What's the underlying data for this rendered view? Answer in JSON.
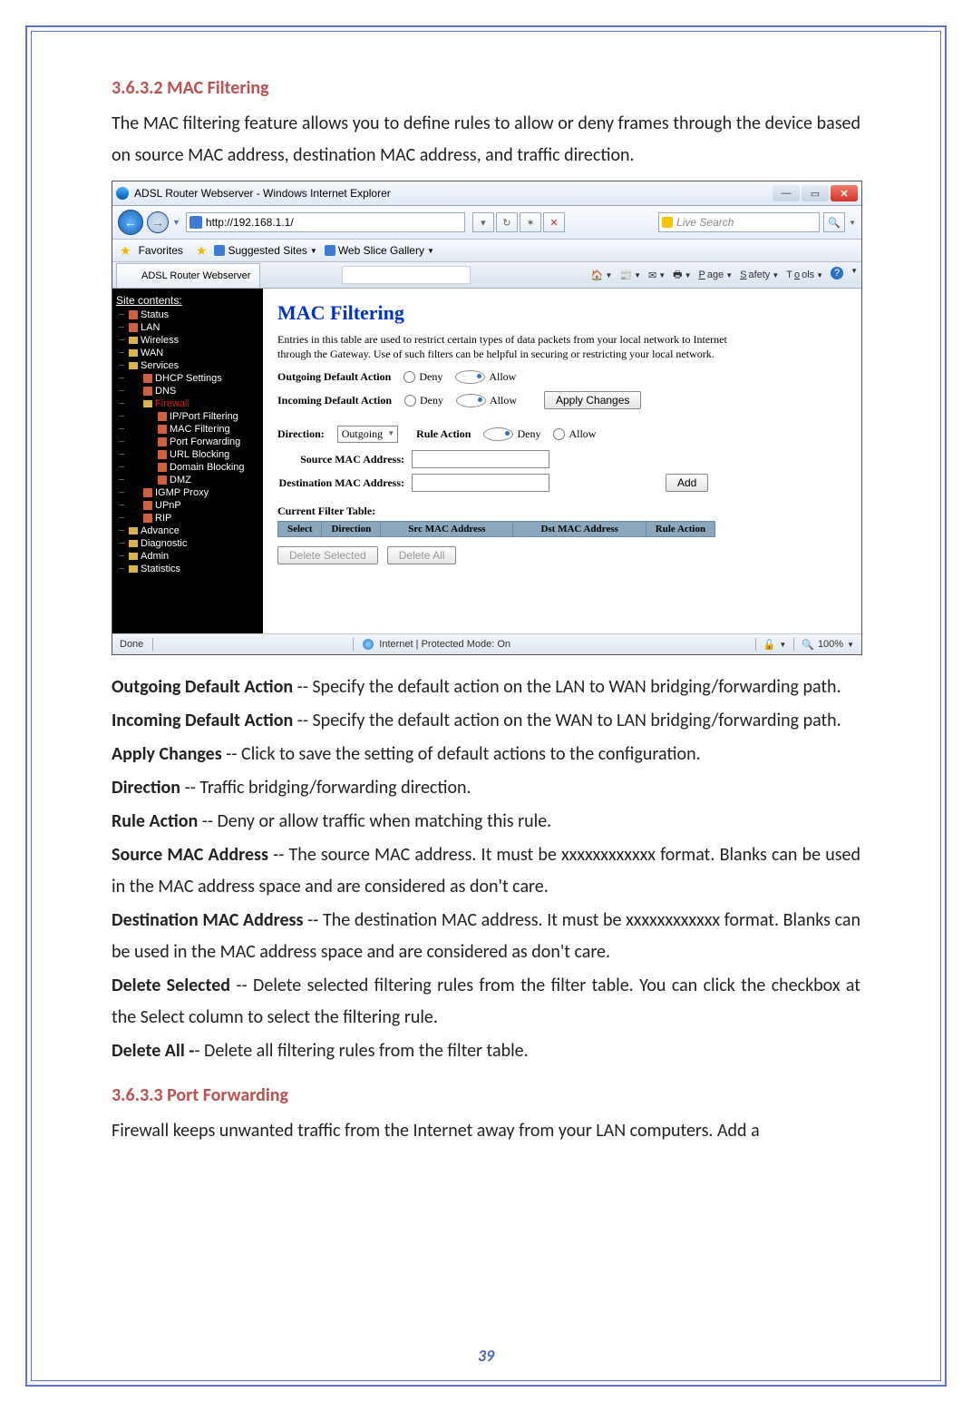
{
  "page_number": "39",
  "sections": {
    "s1": {
      "num": "3.6.3.2",
      "title": "MAC Filtering",
      "intro": "The MAC filtering feature allows you to define rules to allow or deny frames through the device based on source MAC address, destination MAC address, and traffic direction."
    },
    "s2": {
      "num": "3.6.3.3",
      "title": "Port Forwarding",
      "intro": "Firewall keeps unwanted traffic from the Internet away from your LAN computers. Add a"
    }
  },
  "definitions": [
    {
      "term": "Outgoing Default Action",
      "desc": " -- Specify the default action on the LAN to WAN bridging/forwarding path."
    },
    {
      "term": "Incoming Default Action",
      "desc": " -- Specify the default action on the WAN to LAN bridging/forwarding path."
    },
    {
      "term": "Apply Changes",
      "desc": " -- Click to save the setting of default actions to the configuration."
    },
    {
      "term": "Direction",
      "desc": " -- Traffic bridging/forwarding direction."
    },
    {
      "term": "Rule Action",
      "desc": " -- Deny or allow traffic when matching this rule."
    },
    {
      "term": "Source MAC Address",
      "desc": " -- The source MAC address. It must be xxxxxxxxxxxx format. Blanks can be used in the MAC address space and are considered as don't care."
    },
    {
      "term": "Destination MAC Address",
      "desc": " -- The destination MAC address. It must be xxxxxxxxxxxx format. Blanks can be used in the MAC address space and are considered as don't care."
    },
    {
      "term": "Delete Selected",
      "desc": " -- Delete selected filtering rules from the filter table. You can click the checkbox at the Select column to select the filtering rule."
    },
    {
      "term": "Delete All -",
      "desc": "- Delete all filtering rules from the filter table."
    }
  ],
  "ie": {
    "title": "ADSL Router Webserver - Windows Internet Explorer",
    "url": "http://192.168.1.1/",
    "search_placeholder": "Live Search",
    "fav_label": "Favorites",
    "fav_links": [
      "Suggested Sites",
      "Web Slice Gallery"
    ],
    "tab_label": "ADSL Router Webserver",
    "toolbar": [
      "Page",
      "Safety",
      "Tools"
    ],
    "status_left": "Done",
    "status_mid": "Internet | Protected Mode: On",
    "zoom": "100%"
  },
  "tree": {
    "root": "Site contents:",
    "items": [
      {
        "l": 1,
        "t": "file",
        "label": "Status"
      },
      {
        "l": 1,
        "t": "file",
        "label": "LAN"
      },
      {
        "l": 1,
        "t": "folder",
        "label": "Wireless"
      },
      {
        "l": 1,
        "t": "folder",
        "label": "WAN"
      },
      {
        "l": 1,
        "t": "folder",
        "label": "Services",
        "open": true
      },
      {
        "l": 2,
        "t": "file",
        "label": "DHCP Settings"
      },
      {
        "l": 2,
        "t": "file",
        "label": "DNS"
      },
      {
        "l": 2,
        "t": "folder",
        "label": "Firewall",
        "cls": "red",
        "open": true
      },
      {
        "l": 3,
        "t": "file",
        "label": "IP/Port Filtering"
      },
      {
        "l": 3,
        "t": "file",
        "label": "MAC Filtering"
      },
      {
        "l": 3,
        "t": "file",
        "label": "Port Forwarding"
      },
      {
        "l": 3,
        "t": "file",
        "label": "URL Blocking"
      },
      {
        "l": 3,
        "t": "file",
        "label": "Domain Blocking"
      },
      {
        "l": 3,
        "t": "file",
        "label": "DMZ"
      },
      {
        "l": 2,
        "t": "file",
        "label": "IGMP Proxy"
      },
      {
        "l": 2,
        "t": "file",
        "label": "UPnP"
      },
      {
        "l": 2,
        "t": "file",
        "label": "RIP"
      },
      {
        "l": 1,
        "t": "folder",
        "label": "Advance"
      },
      {
        "l": 1,
        "t": "folder",
        "label": "Diagnostic"
      },
      {
        "l": 1,
        "t": "folder",
        "label": "Admin"
      },
      {
        "l": 1,
        "t": "folder",
        "label": "Statistics"
      }
    ]
  },
  "panel": {
    "title": "MAC Filtering",
    "intro": "Entries in this table are used to restrict certain types of data packets from your local network to Internet through the Gateway. Use of such filters can be helpful in securing or restricting your local network.",
    "out_label": "Outgoing Default Action",
    "in_label": "Incoming Default Action",
    "deny": "Deny",
    "allow": "Allow",
    "apply": "Apply Changes",
    "dir_label": "Direction:",
    "dir_value": "Outgoing",
    "rule_label": "Rule Action",
    "src_label": "Source MAC Address:",
    "dst_label": "Destination MAC Address:",
    "add": "Add",
    "ftable_title": "Current Filter Table:",
    "cols": [
      "Select",
      "Direction",
      "Src MAC Address",
      "Dst MAC Address",
      "Rule Action"
    ],
    "del_sel": "Delete Selected",
    "del_all": "Delete All"
  }
}
